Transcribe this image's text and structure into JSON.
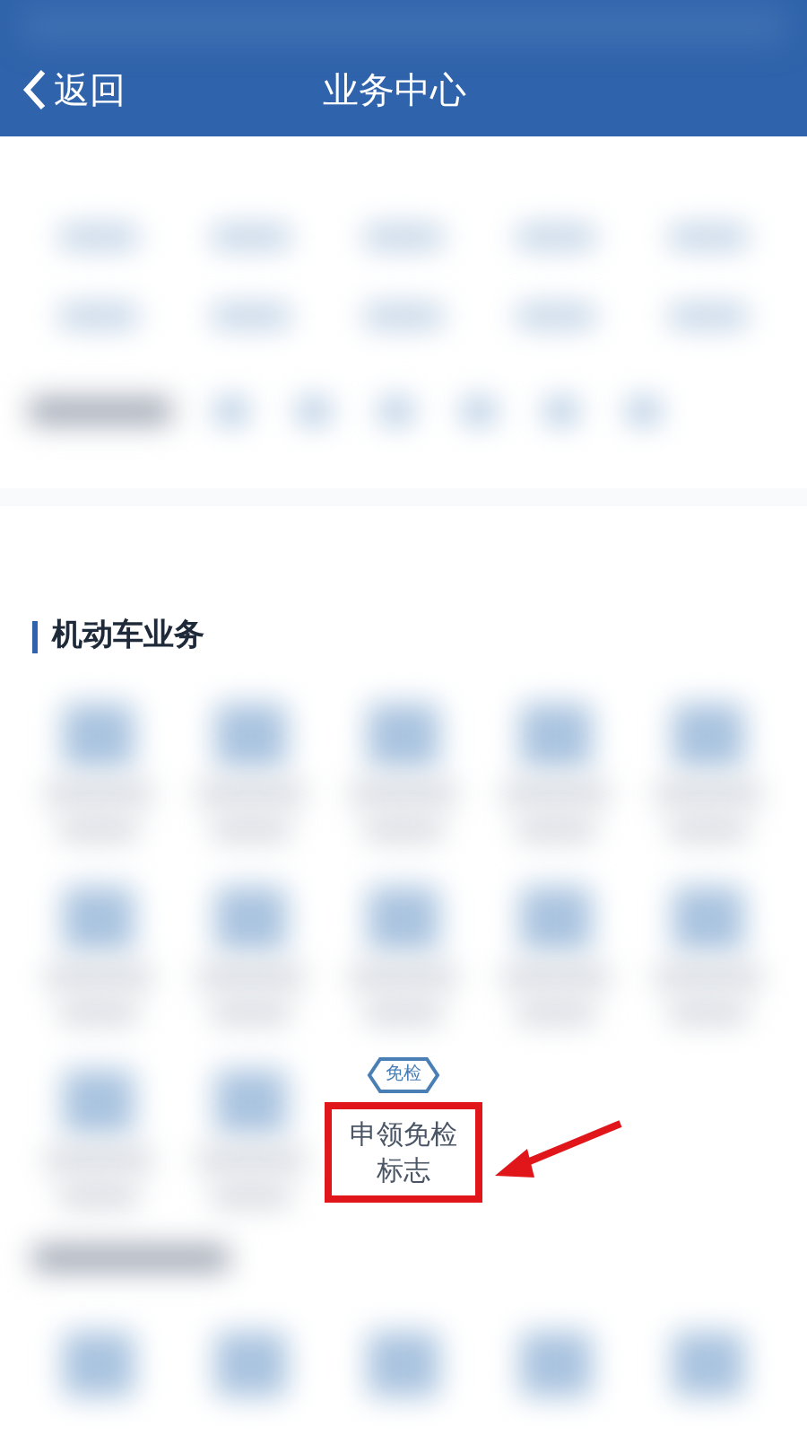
{
  "header": {
    "back_label": "返回",
    "title": "业务中心"
  },
  "section": {
    "title": "机动车业务"
  },
  "featured_item": {
    "badge": "免检",
    "label": "申领免检标志",
    "highlighted": true
  }
}
